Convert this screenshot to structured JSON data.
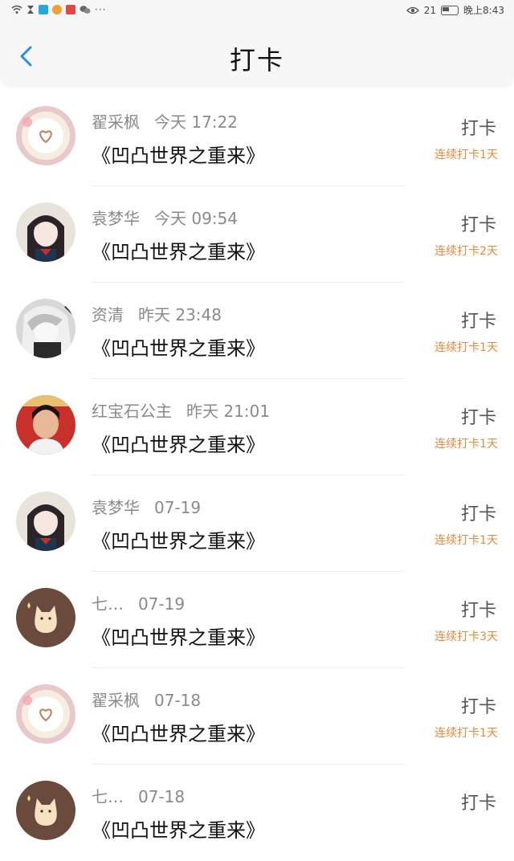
{
  "statusbar": {
    "right_text_signal": "21",
    "time": "晚上8:43",
    "more": "···"
  },
  "header": {
    "title": "打卡"
  },
  "colors": {
    "accent_blue": "#2a8de6",
    "streak_orange": "#e58a3c"
  },
  "items": [
    {
      "name": "翟采枫",
      "time": "今天 17:22",
      "book": "《凹凸世界之重来》",
      "action": "打卡",
      "streak": "连续打卡1天",
      "avatar": "heart-latte"
    },
    {
      "name": "袁梦华",
      "time": "今天 09:54",
      "book": "《凹凸世界之重来》",
      "action": "打卡",
      "streak": "连续打卡2天",
      "avatar": "anime-girl"
    },
    {
      "name": "资清",
      "time": "昨天 23:48",
      "book": "《凹凸世界之重来》",
      "action": "打卡",
      "streak": "连续打卡1天",
      "avatar": "anime-gray"
    },
    {
      "name": "红宝石公主",
      "time": "昨天 21:01",
      "book": "《凹凸世界之重来》",
      "action": "打卡",
      "streak": "连续打卡1天",
      "avatar": "photo-woman"
    },
    {
      "name": "袁梦华",
      "time": "07-19",
      "book": "《凹凸世界之重来》",
      "action": "打卡",
      "streak": "连续打卡1天",
      "avatar": "anime-girl"
    },
    {
      "name": "七…",
      "time": "07-19",
      "book": "《凹凸世界之重来》",
      "action": "打卡",
      "streak": "连续打卡3天",
      "avatar": "cat"
    },
    {
      "name": "翟采枫",
      "time": "07-18",
      "book": "《凹凸世界之重来》",
      "action": "打卡",
      "streak": "连续打卡1天",
      "avatar": "heart-latte"
    },
    {
      "name": "七…",
      "time": "07-18",
      "book": "《凹凸世界之重来》",
      "action": "打卡",
      "streak": "",
      "avatar": "cat"
    }
  ]
}
